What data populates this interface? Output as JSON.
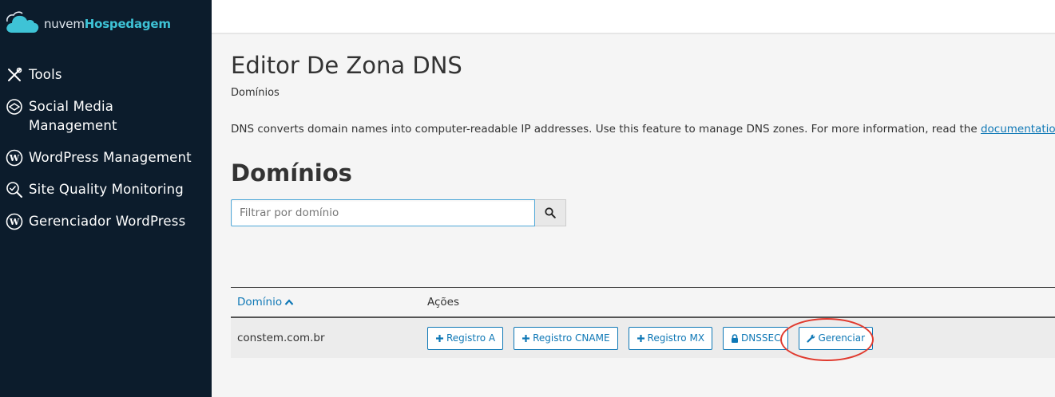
{
  "brand": {
    "light": "nuvem",
    "bold": "Hospedagem",
    "icon": "cloud-icon"
  },
  "sidebar": {
    "items": [
      {
        "label": "Tools",
        "icon": "tools-icon"
      },
      {
        "label": "Social Media Management",
        "icon": "social-media-icon"
      },
      {
        "label": "WordPress Management",
        "icon": "wordpress-icon"
      },
      {
        "label": "Site Quality Monitoring",
        "icon": "site-quality-icon"
      },
      {
        "label": "Gerenciador WordPress",
        "icon": "wordpress-icon"
      }
    ]
  },
  "page": {
    "title": "Editor De Zona DNS",
    "breadcrumb": "Domínios",
    "description": "DNS converts domain names into computer-readable IP addresses. Use this feature to manage DNS zones. For more information, read the ",
    "description_link": "documentation",
    "description_end": ".",
    "section_title": "Domínios"
  },
  "search": {
    "placeholder": "Filtrar por domínio",
    "value": "",
    "icon": "search-icon"
  },
  "table": {
    "headers": {
      "domain": "Domínio",
      "actions": "Ações"
    },
    "rows": [
      {
        "domain": "constem.com.br",
        "actions": [
          {
            "label": "Registro A",
            "icon": "plus-icon"
          },
          {
            "label": "Registro CNAME",
            "icon": "plus-icon"
          },
          {
            "label": "Registro MX",
            "icon": "plus-icon"
          },
          {
            "label": "DNSSEC",
            "icon": "lock-icon"
          },
          {
            "label": "Gerenciar",
            "icon": "wrench-icon"
          }
        ]
      }
    ]
  },
  "colors": {
    "sidebar_bg": "#0c1c2c",
    "brand_accent": "#3ec3d6",
    "link": "#0f78b6",
    "highlight": "#e03a2e"
  }
}
